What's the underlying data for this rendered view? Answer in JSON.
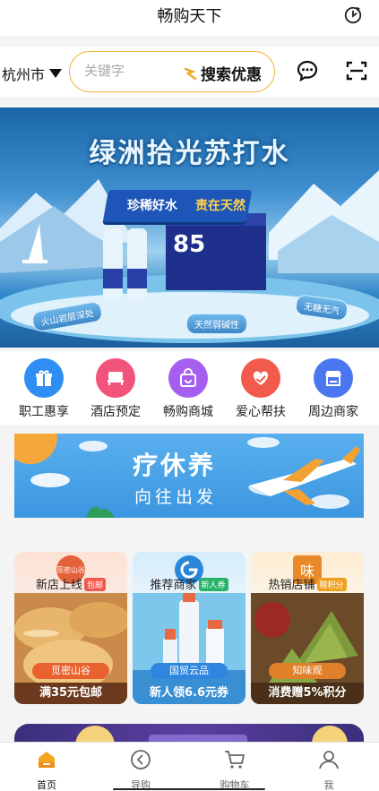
{
  "header": {
    "title": "畅购天下"
  },
  "search": {
    "city": "杭州市",
    "placeholder": "关键字",
    "button_label": "搜索优惠"
  },
  "banner": {
    "headline": "绿洲拾光苏打水",
    "ribbon_left": "珍稀好水",
    "ribbon_right": "责在天然",
    "tags": [
      "火山岩层深处",
      "天然弱碱性",
      "无糖无汽"
    ],
    "product_number": "85"
  },
  "quick_menu": [
    {
      "label": "职工惠享",
      "icon": "gift-icon",
      "color": "#2f8ef3"
    },
    {
      "label": "酒店预定",
      "icon": "hotel-icon",
      "color": "#f2537a"
    },
    {
      "label": "畅购商城",
      "icon": "shopping-bag-icon",
      "color": "#a55ef0"
    },
    {
      "label": "爱心帮扶",
      "icon": "heart-hands-icon",
      "color": "#f25a4c"
    },
    {
      "label": "周边商家",
      "icon": "store-icon",
      "color": "#4a76f0"
    }
  ],
  "ad": {
    "line1": "疗休养",
    "line2": "向往出发"
  },
  "cards": [
    {
      "title": "新店上线",
      "badge": "包邮",
      "badge_color": "#f15a4a",
      "logo_text": "觅密山谷",
      "pill": "觅密山谷",
      "promo": "满35元包邮",
      "accent": "#e86a3a"
    },
    {
      "title": "推荐商家",
      "badge": "新人券",
      "badge_color": "#27b36a",
      "pill": "国贸云品",
      "promo": "新人领6.6元券",
      "accent": "#2e86de"
    },
    {
      "title": "热销店铺",
      "badge": "赠积分",
      "badge_color": "#f0a020",
      "logo_text": "味",
      "pill": "知味观",
      "promo": "消费赠5%积分",
      "accent": "#e0802a"
    }
  ],
  "tabs": [
    {
      "label": "首页",
      "icon": "home-icon",
      "active": true
    },
    {
      "label": "导购",
      "icon": "guide-icon",
      "active": false
    },
    {
      "label": "购物车",
      "icon": "cart-icon",
      "active": false
    },
    {
      "label": "我",
      "icon": "user-icon",
      "active": false
    }
  ]
}
